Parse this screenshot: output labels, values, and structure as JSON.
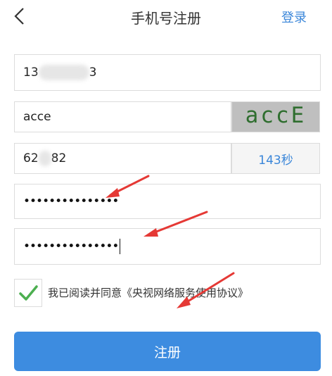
{
  "header": {
    "title": "手机号注册",
    "login_label": "登录",
    "back_icon": "chevron-left-icon"
  },
  "form": {
    "phone": {
      "prefix": "13",
      "suffix": "3",
      "note": "middle digits blurred"
    },
    "captcha": {
      "value": "acce",
      "image_text": "accE"
    },
    "sms_code": {
      "prefix": "62",
      "suffix": "82",
      "countdown": "143秒"
    },
    "password": {
      "dots": "•••••••••••••••"
    },
    "confirm_password": {
      "dots": "•••••••••••••••"
    }
  },
  "agreement": {
    "checked": true,
    "text": "我已阅读并同意《央视网络服务使用协议》"
  },
  "submit_label": "注册",
  "colors": {
    "accent": "#3a86d9",
    "button": "#3d8ce0",
    "check": "#4caf50",
    "arrow": "#e53935"
  }
}
